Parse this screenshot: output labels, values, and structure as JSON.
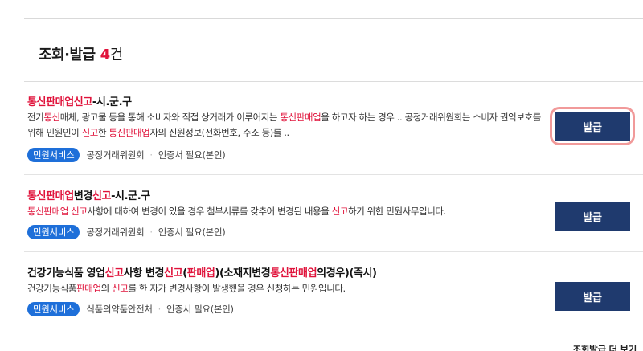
{
  "section": {
    "title": "조회·발급",
    "count": "4",
    "count_unit": "건",
    "footer_link": "조회발급 더 보기"
  },
  "results": [
    {
      "title": [
        {
          "text": "통신판매업신고",
          "hl": true
        },
        {
          "text": "-시.군.구",
          "hl": false
        }
      ],
      "desc": [
        {
          "text": "전기",
          "hl": false
        },
        {
          "text": "통신",
          "hl": true
        },
        {
          "text": "매체, 광고물 등을 통해 소비자와 직접 상거래가 이루어지는 ",
          "hl": false
        },
        {
          "text": "통신판매업",
          "hl": true
        },
        {
          "text": "을 하고자 하는 경우 .. 공정거래위원회는 소비자 권익보호를 위해 민원인이 ",
          "hl": false
        },
        {
          "text": "신고",
          "hl": true
        },
        {
          "text": "한 ",
          "hl": false
        },
        {
          "text": "통신판매업",
          "hl": true
        },
        {
          "text": "자의 신원정보(전화번호, 주소 등)를 ..",
          "hl": false
        }
      ],
      "badge": "민원서비스",
      "agency": "공정거래위원회",
      "requirement": "인증서 필요(본인)",
      "button_label": "발급",
      "highlighted": true
    },
    {
      "title": [
        {
          "text": "통신판매업",
          "hl": true
        },
        {
          "text": "변경",
          "hl": false
        },
        {
          "text": "신고",
          "hl": true
        },
        {
          "text": "-시.군.구",
          "hl": false
        }
      ],
      "desc": [
        {
          "text": "통신판매업 신고",
          "hl": true
        },
        {
          "text": "사항에 대하여 변경이 있을 경우 첨부서류를 갖추어 변경된 내용을 ",
          "hl": false
        },
        {
          "text": "신고",
          "hl": true
        },
        {
          "text": "하기 위한 민원사무입니다.",
          "hl": false
        }
      ],
      "badge": "민원서비스",
      "agency": "공정거래위원회",
      "requirement": "인증서 필요(본인)",
      "button_label": "발급",
      "highlighted": false
    },
    {
      "title": [
        {
          "text": "건강기능식품 영업",
          "hl": false
        },
        {
          "text": "신고",
          "hl": true
        },
        {
          "text": "사항 변경",
          "hl": false
        },
        {
          "text": "신고",
          "hl": true
        },
        {
          "text": "(",
          "hl": false
        },
        {
          "text": "판매업",
          "hl": true
        },
        {
          "text": ")(소재지변경",
          "hl": false
        },
        {
          "text": "통신판매업",
          "hl": true
        },
        {
          "text": "의경우)(즉시)",
          "hl": false
        }
      ],
      "desc": [
        {
          "text": "건강기능식품",
          "hl": false
        },
        {
          "text": "판매업",
          "hl": true
        },
        {
          "text": "의 ",
          "hl": false
        },
        {
          "text": "신고",
          "hl": true
        },
        {
          "text": "를 한 자가 변경사항이 발생했을 경우 신청하는 민원입니다.",
          "hl": false
        }
      ],
      "badge": "민원서비스",
      "agency": "식품의약품안전처",
      "requirement": "인증서 필요(본인)",
      "button_label": "발급",
      "highlighted": false
    }
  ],
  "colors": {
    "highlight": "#e0133b",
    "button": "#1f3a6e",
    "badge": "#1e6fd9",
    "callout_ring": "#f19a9a"
  }
}
